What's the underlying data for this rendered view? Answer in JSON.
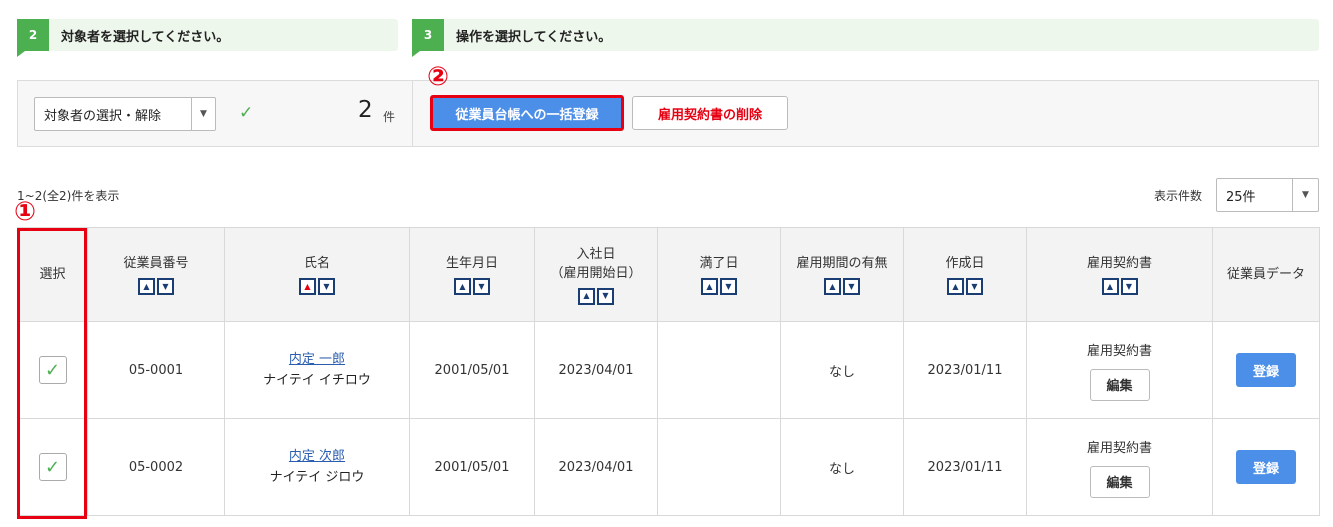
{
  "steps": {
    "step2": {
      "number": "2",
      "text": "対象者を選択してください。"
    },
    "step3": {
      "number": "3",
      "text": "操作を選択してください。"
    }
  },
  "toolbar": {
    "target_select_label": "対象者の選択・解除",
    "selected_count": "2",
    "selected_unit": "件",
    "bulk_register_label": "従業員台帳への一括登録",
    "delete_contract_label": "雇用契約書の削除"
  },
  "annotations": {
    "one": "①",
    "two": "②"
  },
  "list": {
    "range_text": "1~2(全2)件を表示",
    "per_page_label": "表示件数",
    "per_page_value": "25件"
  },
  "table": {
    "headers": {
      "select": "選択",
      "emp_no": "従業員番号",
      "name": "氏名",
      "birth": "生年月日",
      "join_line1": "入社日",
      "join_line2": "（雇用開始日）",
      "expire": "満了日",
      "period": "雇用期間の有無",
      "created": "作成日",
      "contract": "雇用契約書",
      "emp_data": "従業員データ"
    },
    "rows": [
      {
        "emp_no": "05-0001",
        "name": "内定 一郎",
        "kana": "ナイテイ イチロウ",
        "birth": "2001/05/01",
        "join": "2023/04/01",
        "expire": "",
        "period": "なし",
        "created": "2023/01/11",
        "contract_label": "雇用契約書",
        "edit_label": "編集",
        "register_label": "登録"
      },
      {
        "emp_no": "05-0002",
        "name": "内定 次郎",
        "kana": "ナイテイ ジロウ",
        "birth": "2001/05/01",
        "join": "2023/04/01",
        "expire": "",
        "period": "なし",
        "created": "2023/01/11",
        "contract_label": "雇用契約書",
        "edit_label": "編集",
        "register_label": "登録"
      }
    ]
  },
  "icons": {
    "check": "✓",
    "dropdown": "▼",
    "sort_up": "▲",
    "sort_down": "▼"
  },
  "colors": {
    "step_green": "#4caf50",
    "primary_blue": "#4c8fe8",
    "annotation_red": "#e60012",
    "link_blue": "#2a5db0"
  }
}
